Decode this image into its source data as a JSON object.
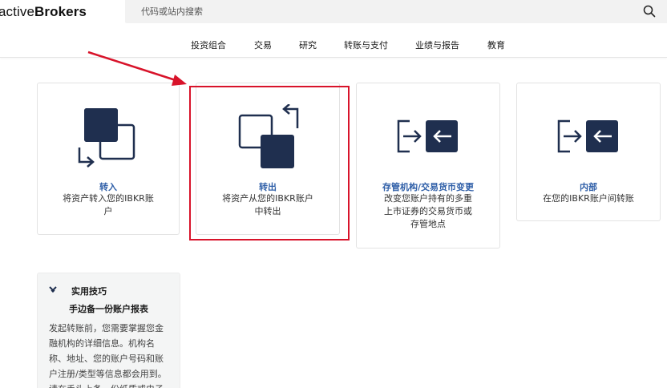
{
  "header": {
    "logo_regular": "active",
    "logo_bold_part": "Brokers",
    "search_placeholder": "代码或站内搜索",
    "search_icon": "search-icon"
  },
  "nav": {
    "items": [
      "投资组合",
      "交易",
      "研究",
      "转账与支付",
      "业绩与报告",
      "教育"
    ]
  },
  "cards": [
    {
      "title": "转入",
      "desc_line1": "将资产转入您的IBKR账",
      "desc_line2": "户",
      "icon": "transfer-in-icon"
    },
    {
      "title": "转出",
      "desc_line1": "将资产从您的IBKR账户",
      "desc_line2": "中转出",
      "icon": "transfer-out-icon"
    },
    {
      "title": "存管机构/交易货币变更",
      "desc_line1": "改变您账户持有的多重",
      "desc_line2": "上市证券的交易货币或",
      "desc_line3": "存管地点",
      "icon": "swap-arrows-icon"
    },
    {
      "title": "内部",
      "desc_line1": "在您的IBKR账户间转账",
      "icon": "swap-arrows-icon"
    }
  ],
  "tip": {
    "label": "实用技巧",
    "title": "手边备一份账户报表",
    "body": "发起转账前，您需要掌握您金融机构的详细信息。机构名称、地址、您的账户号码和账户注册/类型等信息都会用到。请在手头上备一份纸质或电子",
    "icon": "chevron-down-icon"
  },
  "colors": {
    "accent": "#2f5fa8",
    "icon_dark": "#1f2f4f",
    "highlight": "#d8132a"
  }
}
